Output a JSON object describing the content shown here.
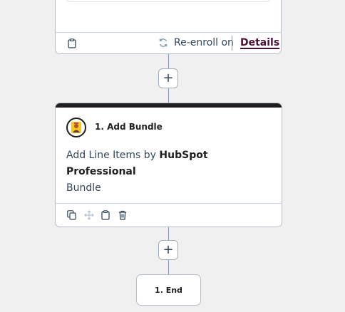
{
  "trigger_card": {
    "clipboard_icon": "clipboard-icon",
    "reenroll_icon": "refresh-icon",
    "reenroll_label": "Re-enroll on",
    "details_link": "Details"
  },
  "add_step_button_1": {
    "label": "+"
  },
  "action_card": {
    "avatar_icon": "bundle-avatar-icon",
    "title": "1. Add Bundle",
    "desc_prefix": "Add Line Items by ",
    "desc_bold": "HubSpot Professional",
    "desc_suffix": "Bundle",
    "toolbar": [
      "copy-icon",
      "move-icon",
      "clipboard-icon",
      "trash-icon"
    ]
  },
  "add_step_button_2": {
    "label": "+"
  },
  "end_node": {
    "label": "1. End"
  },
  "colors": {
    "background": "#f0f0f0",
    "card_border": "#b6bfc8",
    "connector": "#7c98b6",
    "action_topbar": "#1f1f1f",
    "details_link": "#4a1136"
  }
}
